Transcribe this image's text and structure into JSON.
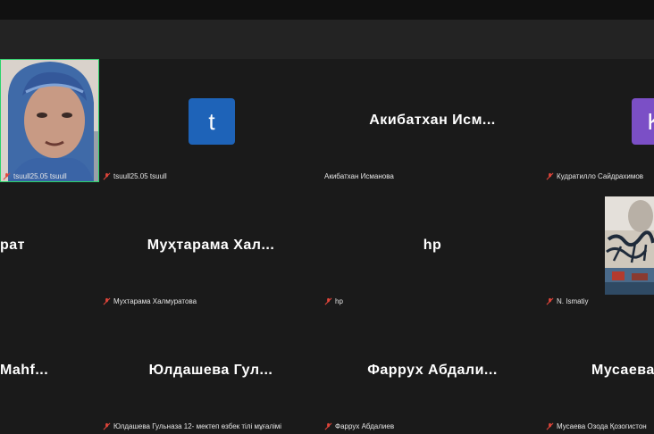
{
  "tiles": [
    {
      "name": "",
      "caption": "tsuull25.05 tsuull"
    },
    {
      "name": "",
      "caption": "Акибатхан Исманова",
      "avatar": "t",
      "avatar_color": "#1e63b8"
    },
    {
      "name": "Акибатхан  Исм...",
      "caption": "Кудратилло Сайдрахимов"
    },
    {
      "name": "",
      "caption": "",
      "avatar": "K",
      "avatar_color": "#7b4fc6"
    },
    {
      "name": "рат",
      "caption": "Мухтарама Халмуратова"
    },
    {
      "name": "Муҳтарама  Хал...",
      "caption": "hp"
    },
    {
      "name": "hp",
      "caption": "N. Ismatiy"
    },
    {
      "name": "",
      "caption": ""
    },
    {
      "name": "Mahf...",
      "caption": "Юлдашева Гульназа 12- мектеп өзбек тілі мұғалімі"
    },
    {
      "name": "Юлдашева  Гул...",
      "caption": "Фаррух Абдалиев"
    },
    {
      "name": "Фаррух  Абдали...",
      "caption": "Мусаева Озода Қозогистон"
    },
    {
      "name": "Мусаева",
      "caption": ""
    }
  ],
  "colors": {
    "background": "#1a1a1a",
    "titlebar": "#232323",
    "active_speaker": "#2bd46b",
    "muted": "#e0453a"
  }
}
